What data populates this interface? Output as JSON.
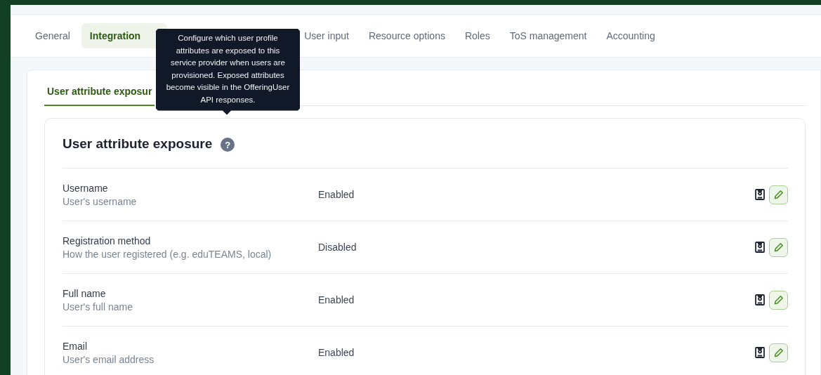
{
  "tabs": [
    {
      "label": "General",
      "selected": false
    },
    {
      "label": "Integration",
      "selected": true
    },
    {
      "label": "User input",
      "selected": false
    },
    {
      "label": "Resource options",
      "selected": false
    },
    {
      "label": "Roles",
      "selected": false
    },
    {
      "label": "ToS management",
      "selected": false
    },
    {
      "label": "Accounting",
      "selected": false
    }
  ],
  "subtabs": [
    {
      "label": "User attribute exposur",
      "selected": true
    }
  ],
  "tooltip": "Configure which user profile attributes are exposed to this service provider when users are provisioned. Exposed attributes become visible in the OfferingUser API responses.",
  "section": {
    "title": "User attribute exposure",
    "help": "?"
  },
  "attributes": [
    {
      "name": "Username",
      "description": "User's username",
      "status": "Enabled"
    },
    {
      "name": "Registration method",
      "description": "How the user registered (e.g. eduTEAMS, local)",
      "status": "Disabled"
    },
    {
      "name": "Full name",
      "description": "User's full name",
      "status": "Enabled"
    },
    {
      "name": "Email",
      "description": "User's email address",
      "status": "Enabled"
    }
  ]
}
